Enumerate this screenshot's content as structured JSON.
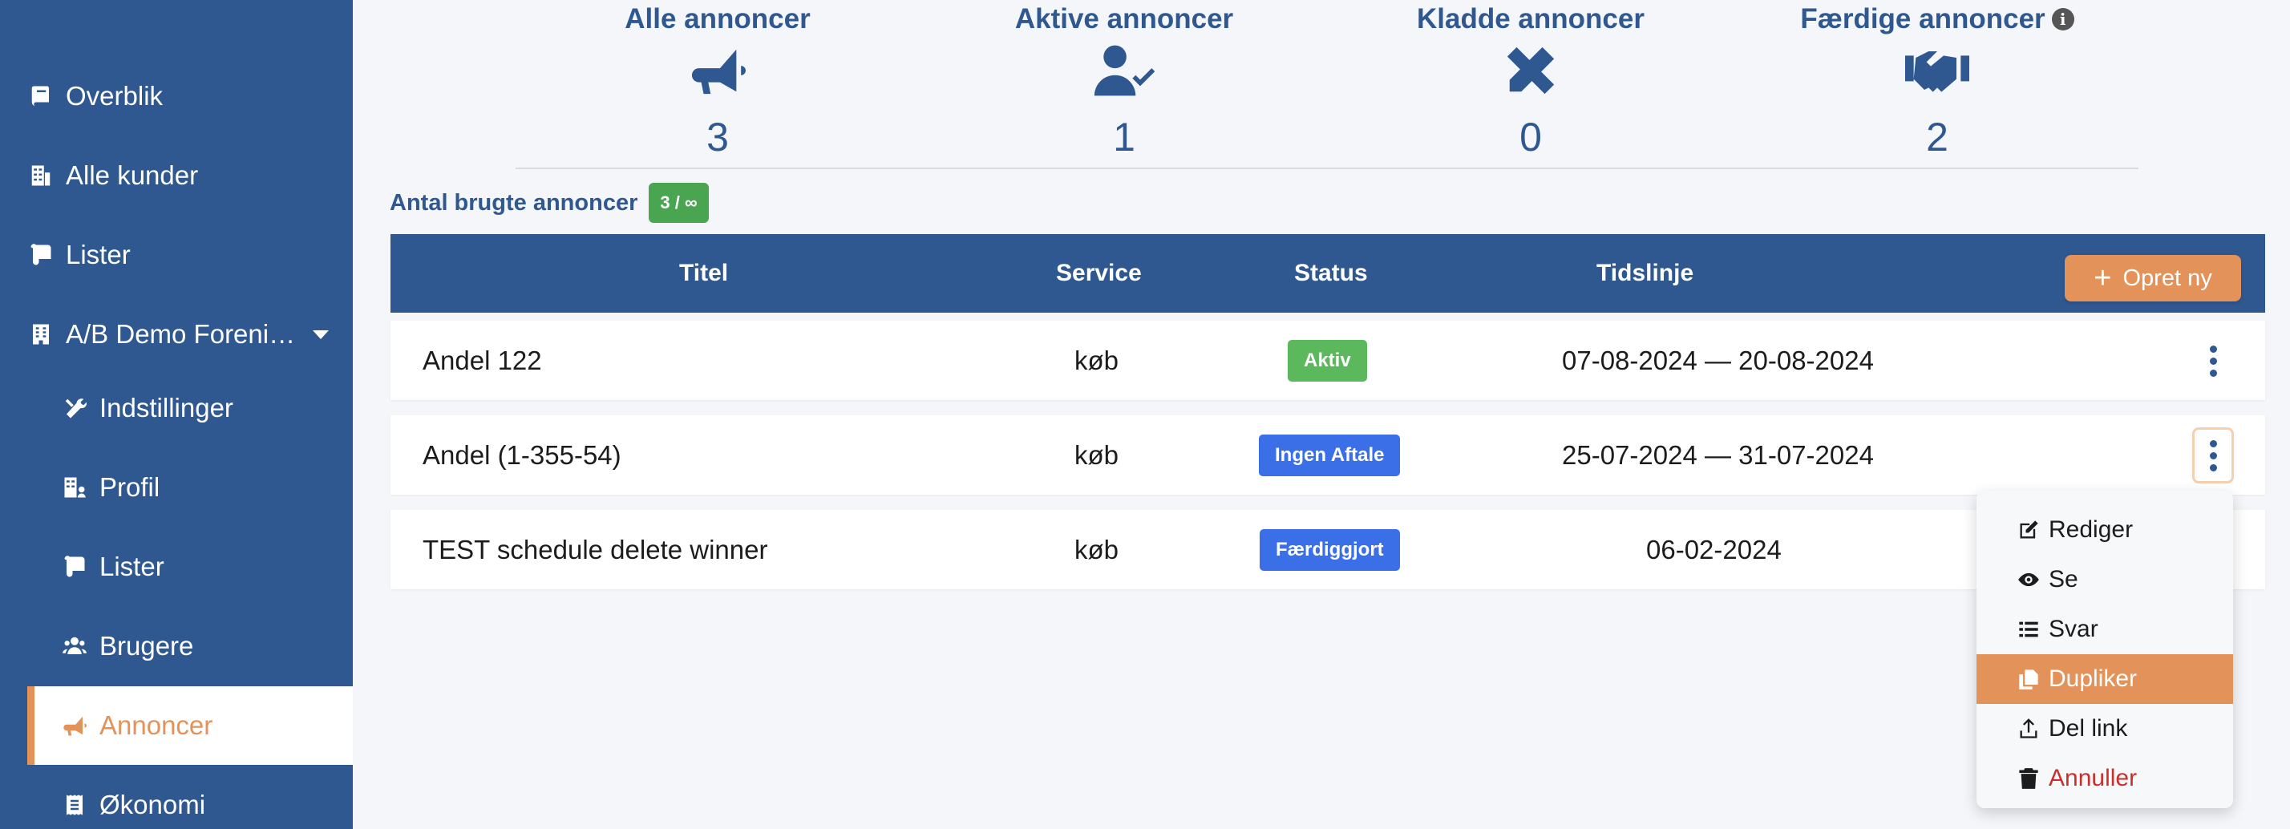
{
  "sidebar": {
    "items": [
      {
        "label": "Overblik",
        "icon": "book-icon"
      },
      {
        "label": "Alle kunder",
        "icon": "building-icon"
      },
      {
        "label": "Lister",
        "icon": "scroll-icon"
      },
      {
        "label": "A/B Demo Foreni…",
        "icon": "building-icon"
      },
      {
        "label": "Indstillinger",
        "icon": "tools-icon"
      },
      {
        "label": "Profil",
        "icon": "building-user-icon"
      },
      {
        "label": "Lister",
        "icon": "scroll-icon"
      },
      {
        "label": "Brugere",
        "icon": "users-icon"
      },
      {
        "label": "Annoncer",
        "icon": "megaphone-icon"
      },
      {
        "label": "Økonomi",
        "icon": "receipt-icon"
      }
    ]
  },
  "stats": [
    {
      "label": "Alle annoncer",
      "value": "3",
      "icon": "megaphone-icon"
    },
    {
      "label": "Aktive annoncer",
      "value": "1",
      "icon": "user-check-icon"
    },
    {
      "label": "Kladde annoncer",
      "value": "0",
      "icon": "pencil-ruler-icon"
    },
    {
      "label": "Færdige annoncer",
      "value": "2",
      "icon": "handshake-icon",
      "info": "i"
    }
  ],
  "usage": {
    "label": "Antal brugte annoncer",
    "badge": "3 / ∞"
  },
  "table": {
    "headers": {
      "title": "Titel",
      "service": "Service",
      "status": "Status",
      "timeline": "Tidslinje"
    },
    "create_label": "Opret ny",
    "create_icon": "+",
    "rows": [
      {
        "title": "Andel 122",
        "service": "køb",
        "status": "Aktiv",
        "status_color": "#5cb85c",
        "timeline": "07-08-2024 — 20-08-2024"
      },
      {
        "title": "Andel (1-355-54)",
        "service": "køb",
        "status": "Ingen Aftale",
        "status_color": "#3a6fe8",
        "timeline": "25-07-2024 — 31-07-2024"
      },
      {
        "title": "TEST schedule delete winner",
        "service": "køb",
        "status": "Færdiggjort",
        "status_color": "#3a6fe8",
        "timeline": "06-02-2024"
      }
    ]
  },
  "menu": {
    "items": [
      {
        "label": "Rediger",
        "icon": "edit-icon"
      },
      {
        "label": "Se",
        "icon": "eye-icon"
      },
      {
        "label": "Svar",
        "icon": "list-icon"
      },
      {
        "label": "Dupliker",
        "icon": "copy-icon",
        "highlighted": true
      },
      {
        "label": "Del link",
        "icon": "share-icon"
      },
      {
        "label": "Annuller",
        "icon": "trash-icon",
        "danger": true
      }
    ]
  },
  "colors": {
    "primary": "#2f5891",
    "accent": "#e3935a",
    "success": "#5cb85c",
    "info": "#3a6fe8",
    "danger": "#c9302c"
  }
}
